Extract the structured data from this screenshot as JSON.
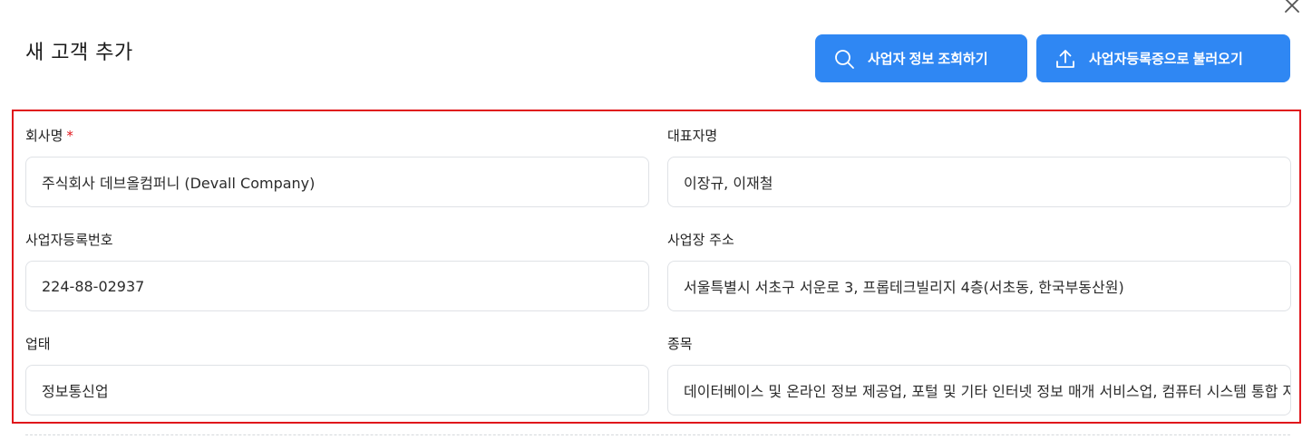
{
  "modal": {
    "title": "새 고객 추가"
  },
  "actions": {
    "lookup_label": "사업자 정보 조회하기",
    "upload_label": "사업자등록증으로 불러오기"
  },
  "form": {
    "company_name": {
      "label": "회사명",
      "required_mark": "*",
      "value": "주식회사 데브올컴퍼니 (Devall Company)"
    },
    "representative": {
      "label": "대표자명",
      "value": "이장규, 이재철"
    },
    "business_number": {
      "label": "사업자등록번호",
      "value": "224-88-02937"
    },
    "business_address": {
      "label": "사업장 주소",
      "value": "서울특별시 서초구 서운로 3, 프롭테크빌리지 4층(서초동, 한국부동산원)"
    },
    "business_type": {
      "label": "업태",
      "value": "정보통신업"
    },
    "business_item": {
      "label": "종목",
      "value": "데이터베이스 및 온라인 정보 제공업, 포털 및 기타 인터넷 정보 매개 서비스업, 컴퓨터 시스템 통합 자문 및 구축 서비스업"
    }
  },
  "colors": {
    "primary": "#2f87f3",
    "highlight_border": "#e0161b",
    "input_border": "#dfe2e6"
  },
  "icons": {
    "close": "close-icon",
    "lookup": "search-icon",
    "upload": "upload-icon"
  }
}
